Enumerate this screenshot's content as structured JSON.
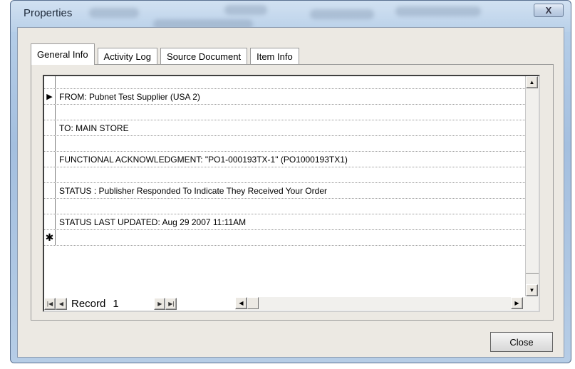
{
  "window": {
    "title": "Properties",
    "close_glyph": "X"
  },
  "tabs": [
    {
      "label": "General Info",
      "active": true
    },
    {
      "label": "Activity Log",
      "active": false
    },
    {
      "label": "Source Document",
      "active": false
    },
    {
      "label": "Item Info",
      "active": false
    }
  ],
  "sheet": {
    "rows": [
      {
        "selector": "current-record",
        "text": "FROM: Pubnet Test Supplier (USA 2)"
      },
      {
        "selector": "",
        "text": ""
      },
      {
        "selector": "",
        "text": "TO: MAIN STORE"
      },
      {
        "selector": "",
        "text": ""
      },
      {
        "selector": "",
        "text": "FUNCTIONAL ACKNOWLEDGMENT: \"PO1-000193TX-1\" (PO1000193TX1)"
      },
      {
        "selector": "",
        "text": ""
      },
      {
        "selector": "",
        "text": "STATUS : Publisher Responded To Indicate They Received Your Order"
      },
      {
        "selector": "",
        "text": ""
      },
      {
        "selector": "",
        "text": "STATUS LAST UPDATED: Aug 29 2007 11:11AM"
      },
      {
        "selector": "new-record",
        "text": ""
      }
    ]
  },
  "navbar": {
    "label": "Record",
    "record": "1"
  },
  "buttons": {
    "close": "Close"
  },
  "icons": {
    "current_record": "▶",
    "new_record": "✱"
  }
}
